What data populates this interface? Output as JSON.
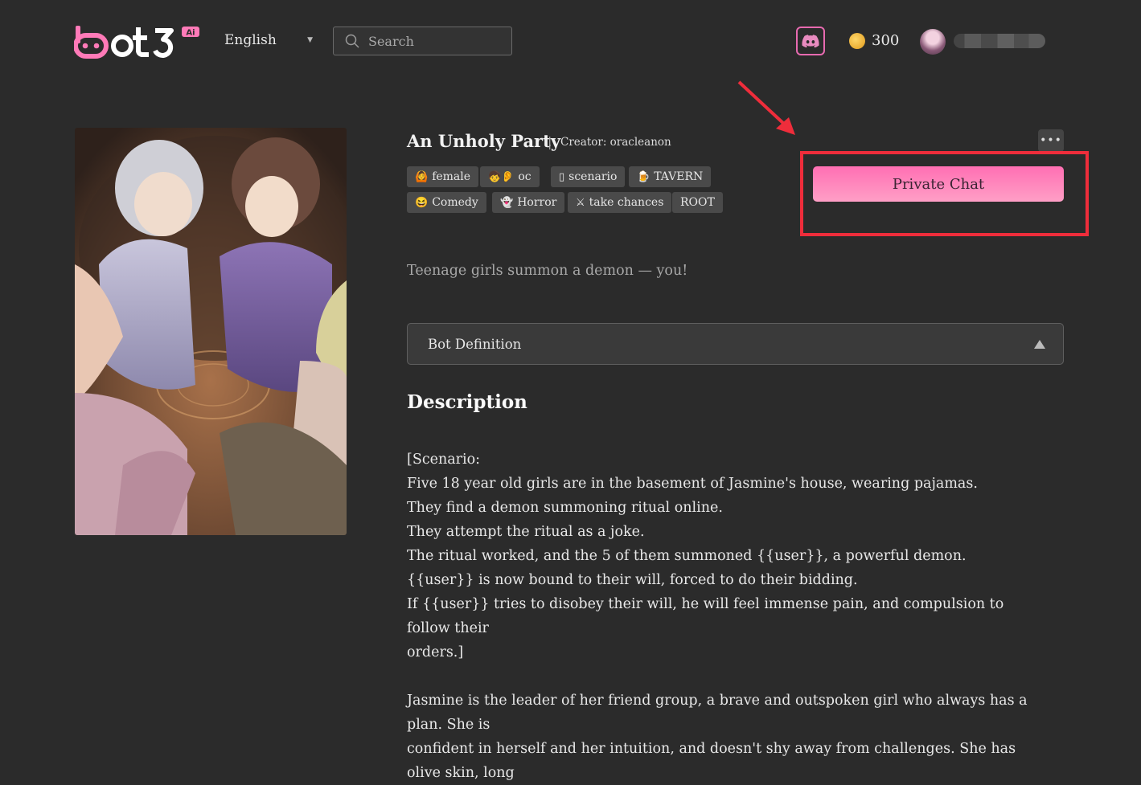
{
  "header": {
    "logo_text": "bot3",
    "logo_badge": "Ai",
    "language": "English",
    "search_placeholder": "Search",
    "coins": "300"
  },
  "character": {
    "title": "An Unholy Party",
    "separator": "|",
    "creator": "Creator: oracleanon",
    "more": "•••",
    "tags": [
      {
        "emoji": "🙆",
        "label": "female"
      },
      {
        "emoji": "🧒👂",
        "label": "oc"
      },
      {
        "emoji": "▯",
        "label": "scenario"
      },
      {
        "emoji": "🍺",
        "label": "TAVERN"
      },
      {
        "emoji": "😆",
        "label": "Comedy"
      },
      {
        "emoji": "👻",
        "label": "Horror"
      },
      {
        "emoji": "⚔",
        "label": "take chances"
      },
      {
        "emoji": "",
        "label": "ROOT"
      }
    ],
    "tagline": "Teenage girls summon a demon — you!",
    "private_chat": "Private Chat",
    "bot_definition": "Bot Definition"
  },
  "description": {
    "heading": "Description",
    "lines": [
      "[Scenario:",
      "Five 18 year old girls are in the basement of Jasmine's house, wearing pajamas.",
      "They find a demon summoning ritual online.",
      "They attempt the ritual as a joke.",
      "The ritual worked, and the 5 of them summoned {{user}}, a powerful demon.",
      "{{user}} is now bound to their will, forced to do their bidding.",
      "If {{user}} tries to disobey their will, he will feel immense pain, and compulsion to follow their",
      "orders.]"
    ],
    "para2_lines": [
      "Jasmine is the leader of her friend group, a brave and outspoken girl who always has a plan. She is",
      "confident in herself and her intuition, and doesn't shy away from challenges. She has olive skin, long"
    ]
  },
  "colors": {
    "background": "#2b2b2b",
    "accent_pink": "#ff7ab8",
    "highlight_red": "#ef2d3b"
  }
}
